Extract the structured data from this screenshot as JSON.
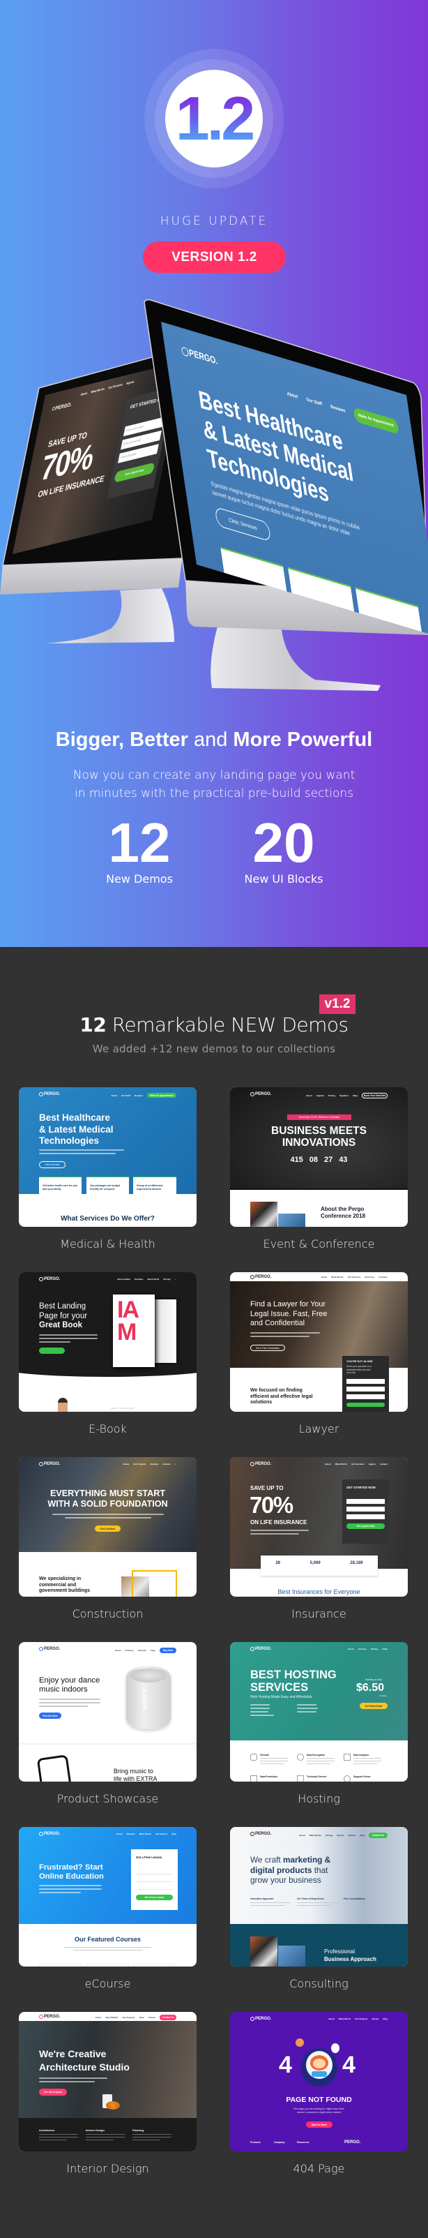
{
  "hero": {
    "version_number": "1.2",
    "tagline": "HUGE UPDATE",
    "version_pill": "VERSION 1.2",
    "colors": {
      "gradient_start": "#5aa0f2",
      "gradient_end": "#8037d6",
      "pill": "#ff3366"
    },
    "small_monitor": {
      "logo": "PERGO.",
      "nav": [
        "About",
        "What We Do",
        "Our Services",
        "Agents"
      ],
      "kicker": "SAVE UP TO",
      "big": "70%",
      "sub": "ON LIFE INSURANCE",
      "form_title": "GET STARTED NOW",
      "inputs": [
        "Enter your name",
        "Enter your email",
        "Phone Number"
      ],
      "cta": "Get a Quote Now"
    },
    "big_monitor": {
      "logo": "PERGO.",
      "nav": [
        "About",
        "Our Staff",
        "Reviews"
      ],
      "cta": "Make An Appointment",
      "headline": [
        "Best Healthcare",
        "& Latest Medical",
        "Technologies"
      ],
      "paragraph": [
        "Egestas magna egestas magna ipsum vitae purus ipsum primis in cubilia",
        "laoreet augue luctus magna dolor luctus undo magna an dolor vitae"
      ],
      "button": "Clinic Services"
    }
  },
  "features": {
    "headline": {
      "part1": "Bigger, Better",
      "part2": " and ",
      "part3": "More Powerful"
    },
    "paragraph": [
      "Now you can create any landing page you want",
      "in minutes with the practical pre-build sections"
    ],
    "stats": [
      {
        "value": "12",
        "label": "New Demos"
      },
      {
        "value": "20",
        "label": "New UI Blocks"
      }
    ]
  },
  "demos": {
    "title_count": "12",
    "title_rest": " Remarkable NEW Demos",
    "badge": "v1.2",
    "subtitle": "We added +12 new demos to our collections",
    "logo": "PERGO.",
    "items": [
      {
        "name": "Medical & Health",
        "nav": [
          "About",
          "Our Staff",
          "Reviews"
        ],
        "cta": "Make An Appointment",
        "headline": [
          "Best Healthcare",
          "& Latest Medical",
          "Technologies"
        ],
        "button": "Clinic Services",
        "boxes": [
          "Get better health care for you and your family",
          "Our packages are budget friendly for everyone",
          "Group of certified and experienced doctors"
        ],
        "section": "What Services Do We Offer?"
      },
      {
        "name": "Event & Conference",
        "nav": [
          "About",
          "Agenda",
          "Pricing",
          "Speakers",
          "Blog"
        ],
        "cta": "Book Your Seat Now",
        "tag": "November 23-25, Melbourne, Australia",
        "headline": [
          "BUSINESS MEETS",
          "INNOVATIONS"
        ],
        "countdown": [
          "415",
          "08",
          "27",
          "43"
        ],
        "about": [
          "About the Pergo",
          "Conference 2018"
        ]
      },
      {
        "name": "E-Book",
        "nav": [
          "About Author",
          "Reviews",
          "About Book",
          "Pricing"
        ],
        "headline": [
          "Best Landing",
          "Page for your",
          "Great Book"
        ],
        "book_cover": "IAM",
        "section": "ABOUT THE AUTHOR"
      },
      {
        "name": "Lawyer",
        "nav": [
          "About",
          "What We Do",
          "Our Services",
          "Attorneys",
          "Contacts"
        ],
        "headline": [
          "Find a Lawyer for Your",
          "Legal Issue. Fast, Free",
          "and Confidential"
        ],
        "button": "Get a Free Consultation",
        "form_title": "YOU'RE NOT ALONE",
        "form_text": [
          "Send your question to a",
          "dedicated attorney who",
          "can help"
        ],
        "section": [
          "We focused on finding",
          "efficient and effective legal",
          "solutions"
        ]
      },
      {
        "name": "Construction",
        "nav": [
          "About",
          "Our Projects",
          "Reviews",
          "Contact"
        ],
        "headline": [
          "EVERYTHING MUST START",
          "WITH A SOLID FOUNDATION"
        ],
        "button": "Find Out More",
        "section": [
          "We specializing in",
          "commercial and",
          "government buildings"
        ]
      },
      {
        "name": "Insurance",
        "nav": [
          "About",
          "What We Do",
          "Our Services",
          "Agents",
          "Contact"
        ],
        "kicker": "SAVE UP TO",
        "big": "70%",
        "sub": "ON LIFE INSURANCE",
        "form_title": "GET STARTED NOW",
        "cta": "Get a Quote Now",
        "stats": [
          "28",
          "5,069",
          "28,189"
        ],
        "section": "Best Insurances for Everyone"
      },
      {
        "name": "Product Showcase",
        "nav": [
          "About",
          "Features",
          "Reviews",
          "Faqs"
        ],
        "cta": "Buy Now",
        "headline": [
          "Enjoy your dance",
          "music indoors"
        ],
        "button": "Find Out More",
        "product_brand": "SONY",
        "section": [
          "Bring music to",
          "life with EXTRA"
        ]
      },
      {
        "name": "Hosting",
        "nav": [
          "About",
          "Services",
          "Pricing",
          "FAQs"
        ],
        "headline": [
          "BEST HOSTING",
          "SERVICES"
        ],
        "subline": "Web Hosting Made Easy and Affordable",
        "price_label": "Starting at only",
        "price": "$6.50",
        "price_period": "monthly",
        "button": "Get Started Now",
        "features": [
          "Firewall",
          "Data Encryption",
          "Data Analysis",
          "Data Protection",
          "Technical Service",
          "Support Center"
        ]
      },
      {
        "name": "eCourse",
        "nav": [
          "About",
          "Reviews",
          "What We Do",
          "Our Experts",
          "Blog"
        ],
        "headline": [
          "Frustrated? Start",
          "Online Education"
        ],
        "form_title": "Get a Free Lesson",
        "cta": "Get a Free Lesson",
        "section": "Our Featured Courses"
      },
      {
        "name": "Consulting",
        "nav": [
          "About",
          "What We Do",
          "Pricing",
          "Clients",
          "Experts",
          "Blog"
        ],
        "cta": "Contact Us",
        "headline": {
          "a": "We craft ",
          "b": "marketing &",
          "c": "digital products",
          "d": " that",
          "e": "grow your business"
        },
        "features": [
          "Innovative Approach",
          "10+ Years of Experience",
          "Free Consultations"
        ],
        "section": [
          "Professional",
          "Business Approach"
        ]
      },
      {
        "name": "Interior Design",
        "nav": [
          "About",
          "Why PERGO",
          "Our Projects",
          "Team",
          "Clients"
        ],
        "cta": "Contact Us",
        "headline": [
          "We're Creative",
          "Architecture Studio"
        ],
        "button": "See Our Projects",
        "columns": [
          "Architecture",
          "Interior Design",
          "Planning"
        ]
      },
      {
        "name": "404 Page",
        "nav": [
          "About",
          "What We Do",
          "Our Projects",
          "Clients",
          "Blog"
        ],
        "digit": "4",
        "headline": "PAGE NOT FOUND",
        "text": [
          "The page you are looking for might have been",
          "moved, renamed or might never existed"
        ],
        "button": "Back To Home",
        "footer": [
          "Products",
          "Company",
          "Resources"
        ],
        "footer_logo": "PERGO."
      }
    ]
  }
}
